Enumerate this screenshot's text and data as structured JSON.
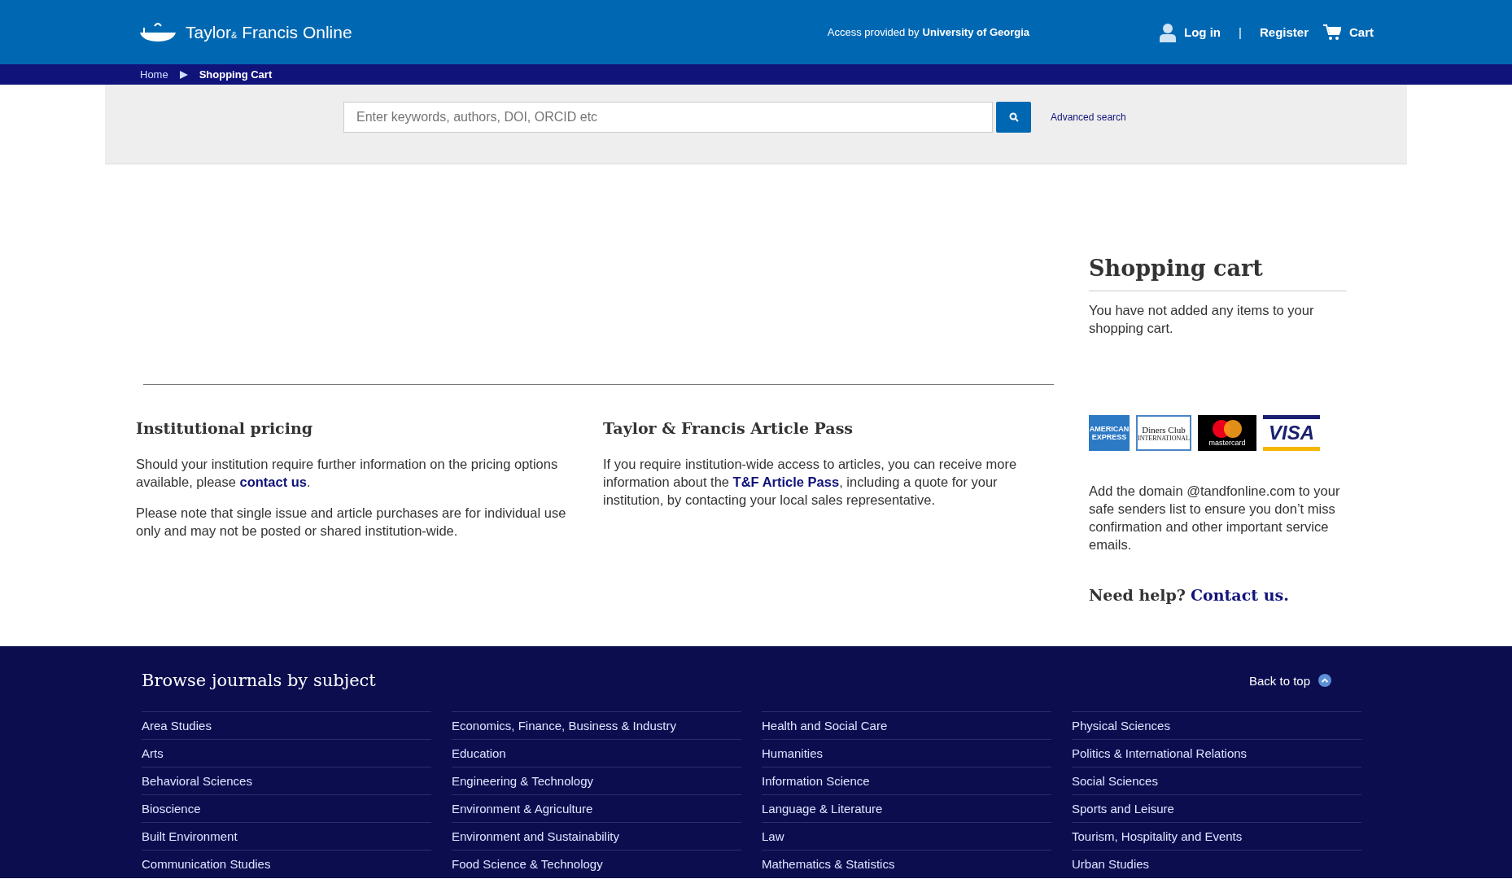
{
  "header": {
    "logo": {
      "brand": "Taylor",
      "amp": "&",
      "rest": "Francis Online"
    },
    "access_text": "Access provided by",
    "institution": "University of Georgia",
    "login": "Log in",
    "separator": "|",
    "register": "Register",
    "cart": "Cart"
  },
  "breadcrumb": [
    {
      "label": "Home",
      "current": false
    },
    {
      "label": "Shopping Cart",
      "current": true
    }
  ],
  "search": {
    "placeholder": "Enter keywords, authors, DOI, ORCID etc",
    "advanced": "Advanced search"
  },
  "sections": [
    {
      "title": "Institutional pricing",
      "paragraphs": [
        "Should your institution require further information on the pricing options available, please **contact us**.",
        "Please note that single issue and article purchases are for individual use only and may not be posted or shared institution-wide."
      ]
    },
    {
      "title": "Taylor & Francis Article Pass",
      "paragraphs": [
        "If you require institution-wide access to articles, you can receive more information about the **T&F Article Pass**, including a quote for your institution, by contacting your local sales representative."
      ]
    }
  ],
  "sidebar": {
    "title": "Shopping cart",
    "empty_text": "You have not added any items to your shopping cart.",
    "cards": [
      {
        "kind": "amex",
        "lines": [
          "AMERICAN",
          "EXPRESS"
        ]
      },
      {
        "kind": "diners",
        "lines": [
          "Diners Club",
          "INTERNATIONAL"
        ]
      },
      {
        "kind": "mastercard",
        "lines": [
          "mastercard"
        ]
      },
      {
        "kind": "visa",
        "lines": [
          "VISA"
        ]
      }
    ],
    "safe_senders": "Add the domain @tandfonline.com to your safe senders list to ensure you don’t miss confirmation and other important service emails.",
    "help": "Need help?",
    "help_link": "Contact us."
  },
  "footer": {
    "title": "Browse journals by subject",
    "back_to_top": "Back to top",
    "columns": [
      [
        "Area Studies",
        "Arts",
        "Behavioral Sciences",
        "Bioscience",
        "Built Environment",
        "Communication Studies"
      ],
      [
        "Economics, Finance, Business & Industry",
        "Education",
        "Engineering & Technology",
        "Environment & Agriculture",
        "Environment and Sustainability",
        "Food Science & Technology"
      ],
      [
        "Health and Social Care",
        "Humanities",
        "Information Science",
        "Language & Literature",
        "Law",
        "Mathematics & Statistics"
      ],
      [
        "Physical Sciences",
        "Politics & International Relations",
        "Social Sciences",
        "Sports and Leisure",
        "Tourism, Hospitality and Events",
        "Urban Studies"
      ]
    ]
  }
}
